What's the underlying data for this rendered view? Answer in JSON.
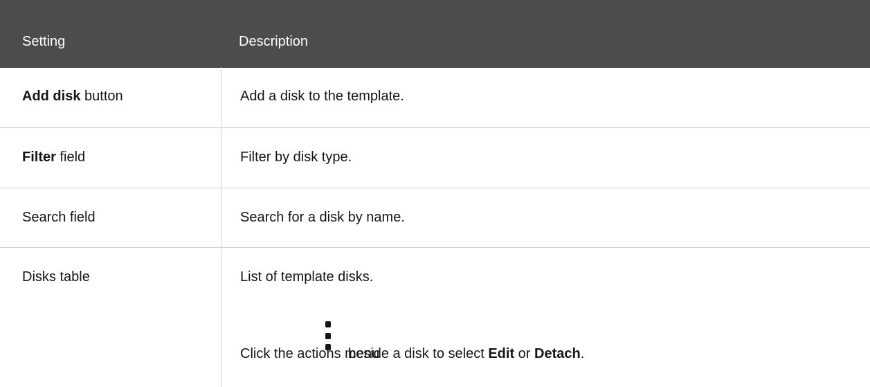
{
  "header": {
    "setting": "Setting",
    "description": "Description"
  },
  "rows": [
    {
      "setting_strong": "Add disk",
      "setting_rest": " button",
      "description": "Add a disk to the template."
    },
    {
      "setting_strong": "Filter",
      "setting_rest": " field",
      "description": "Filter by disk type."
    },
    {
      "setting_strong": "",
      "setting_rest": "Search field",
      "description": "Search for a disk by name."
    },
    {
      "setting_strong": "",
      "setting_rest": "Disks table",
      "description": "List of template disks.",
      "description2_prefix": "Click the actions menu",
      "description2_middle": "beside a disk to select ",
      "description2_edit": "Edit",
      "description2_or": " or ",
      "description2_detach": "Detach",
      "description2_end": "."
    }
  ],
  "icons": {
    "actions_menu": "kebab-icon"
  },
  "colors": {
    "header_bg": "#4c4c4c",
    "header_text": "#ffffff",
    "border": "#d2d2d2",
    "text": "#151515"
  }
}
